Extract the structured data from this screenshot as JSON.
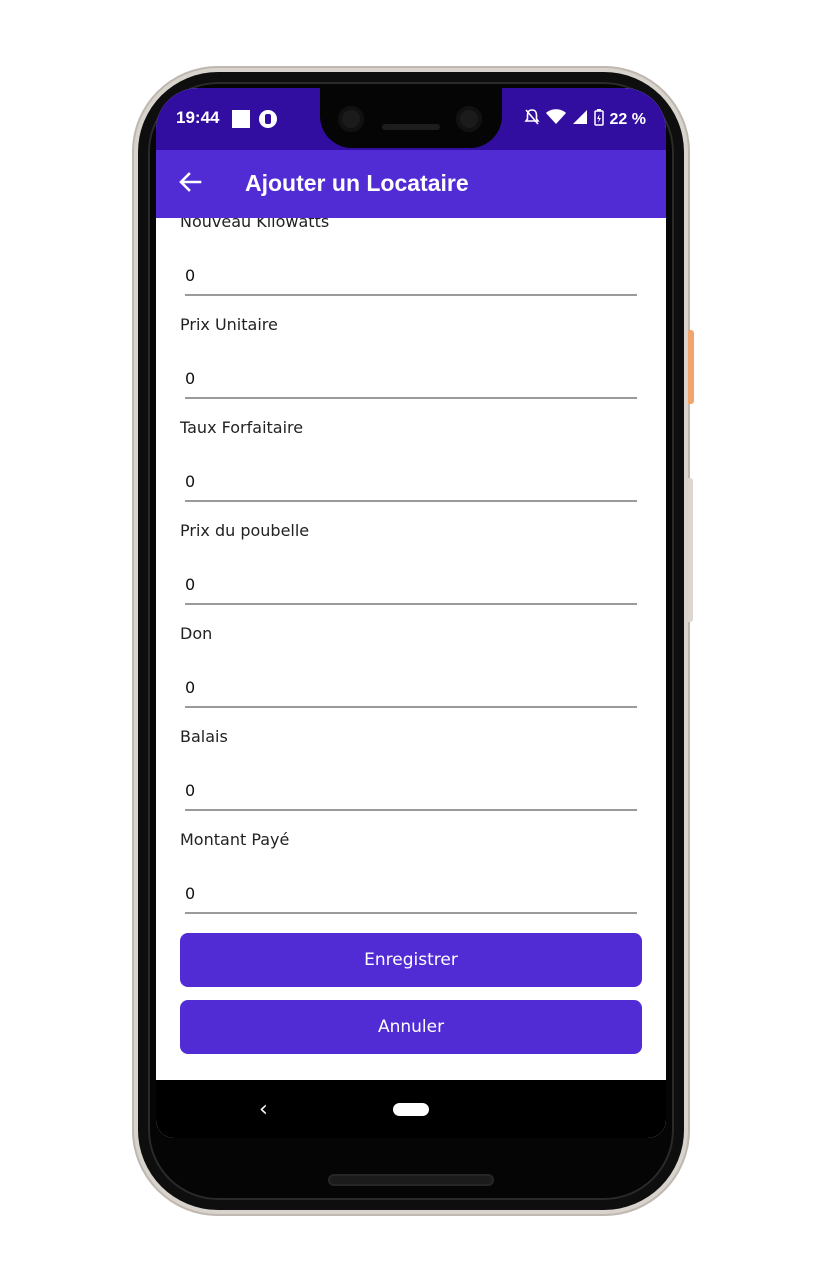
{
  "status_bar": {
    "time": "19:44",
    "battery_text": "22 %",
    "icons": [
      "square-notification-icon",
      "app-notification-icon",
      "mute-icon",
      "wifi-icon",
      "signal-icon",
      "battery-charging-icon"
    ]
  },
  "app_bar": {
    "title": "Ajouter un Locataire",
    "back_icon": "arrow-left-icon"
  },
  "form": {
    "fields": [
      {
        "label": "Nouveau Kilowatts",
        "value": "0"
      },
      {
        "label": "Prix Unitaire",
        "value": "0"
      },
      {
        "label": "Taux Forfaitaire",
        "value": "0"
      },
      {
        "label": "Prix du poubelle",
        "value": "0"
      },
      {
        "label": "Don",
        "value": "0"
      },
      {
        "label": "Balais",
        "value": "0"
      },
      {
        "label": "Montant Payé",
        "value": "0"
      }
    ],
    "save_label": "Enregistrer",
    "cancel_label": "Annuler"
  },
  "nav_bar": {
    "back_glyph": "‹"
  },
  "colors": {
    "status_bar": "#320ea0",
    "app_bar": "#512bd4",
    "button": "#512bd4"
  }
}
